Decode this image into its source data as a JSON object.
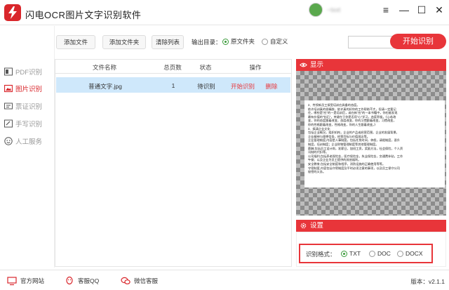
{
  "app": {
    "title": "闪电OCR图片文字识别软件",
    "user_name": "~txxt"
  },
  "window_controls": {
    "menu": "≡",
    "minimize": "—",
    "maximize": "☐",
    "close": "✕"
  },
  "sidebar": {
    "items": [
      {
        "label": "PDF识别",
        "icon": "pdf-icon",
        "active": false
      },
      {
        "label": "图片识别",
        "icon": "image-icon",
        "active": true
      },
      {
        "label": "票证识别",
        "icon": "ticket-icon",
        "active": false
      },
      {
        "label": "手写识别",
        "icon": "handwriting-icon",
        "active": false
      },
      {
        "label": "人工服务",
        "icon": "service-icon",
        "active": false
      }
    ]
  },
  "toolbar": {
    "add_file": "添加文件",
    "add_folder": "添加文件夹",
    "clear_list": "清除列表",
    "output_label": "输出目录：",
    "output_options": [
      {
        "label": "原文件夹",
        "selected": true
      },
      {
        "label": "自定义",
        "selected": false
      }
    ],
    "output_path": "",
    "start_button": "开始识别"
  },
  "table": {
    "headers": [
      "文件名称",
      "总页数",
      "状态",
      "操作"
    ],
    "rows": [
      {
        "name": "普通文字.jpg",
        "pages": "1",
        "status": "待识别",
        "action_start": "开始识别",
        "action_delete": "删除"
      }
    ]
  },
  "preview": {
    "title": "显示",
    "doc_lines": [
      "2、传授新员工接受培训应具备的态度。",
      "  依许培训真的很精辟，依许真的好你的工作帮助不大，但请一定要记",
      "  住，哪些是\"应\"的一是培训后，或在新\"应\"的一本书籍中，你也能发现",
      "  最有价值的\"钻石\"，关键在于你是否用\"心\"学习，态度积极，《心若改",
      "  变，你的态度跟着改变，态度改变，你的习惯跟着改变，习惯改变，",
      "  你的性格跟着改变，性格改变，你的人生跟着改变。》",
      "3、搞清企业文化",
      "包括企业概况，组织机构，企业的产品或经营范围，企业的发展背景，",
      "  企业精神与理想信条，经营目标与价值观念等。",
      "企业管理制度,内容是人事制度，包括任免时间，休假，请假制度，晋升",
      "  制度，培训制度；企业财物管理制度等其他管理制度。",
      "薪酬,包括员工设计岗，发薪日，加班工资，奖励方法，社会保险，个人资",
      "  讯制的代扣等。",
      "公司福利,包括养老保险金，医疗保险金，失业保险金，交通费补贴，工作",
      "  午餐；以及企业为员工提供的其他福利。",
      "安全教育,包括安全制度和程序，消防设施的正确使用等等。",
      "守密制度,内容包括守密制度及平时必须注意的事项，以及员工保守公司",
      "  秘密的义务。"
    ]
  },
  "settings": {
    "title": "设置",
    "format_label": "识别格式：",
    "formats": [
      {
        "label": "TXT",
        "selected": true
      },
      {
        "label": "DOC",
        "selected": false
      },
      {
        "label": "DOCX",
        "selected": false
      }
    ]
  },
  "footer": {
    "website": "官方网站",
    "qq": "客服QQ",
    "wechat": "微信客服",
    "version": "版本：v2.1.1"
  },
  "colors": {
    "accent": "#e8353a",
    "selected_row": "#cfe8fb",
    "radio_on": "#3a9a3a"
  }
}
